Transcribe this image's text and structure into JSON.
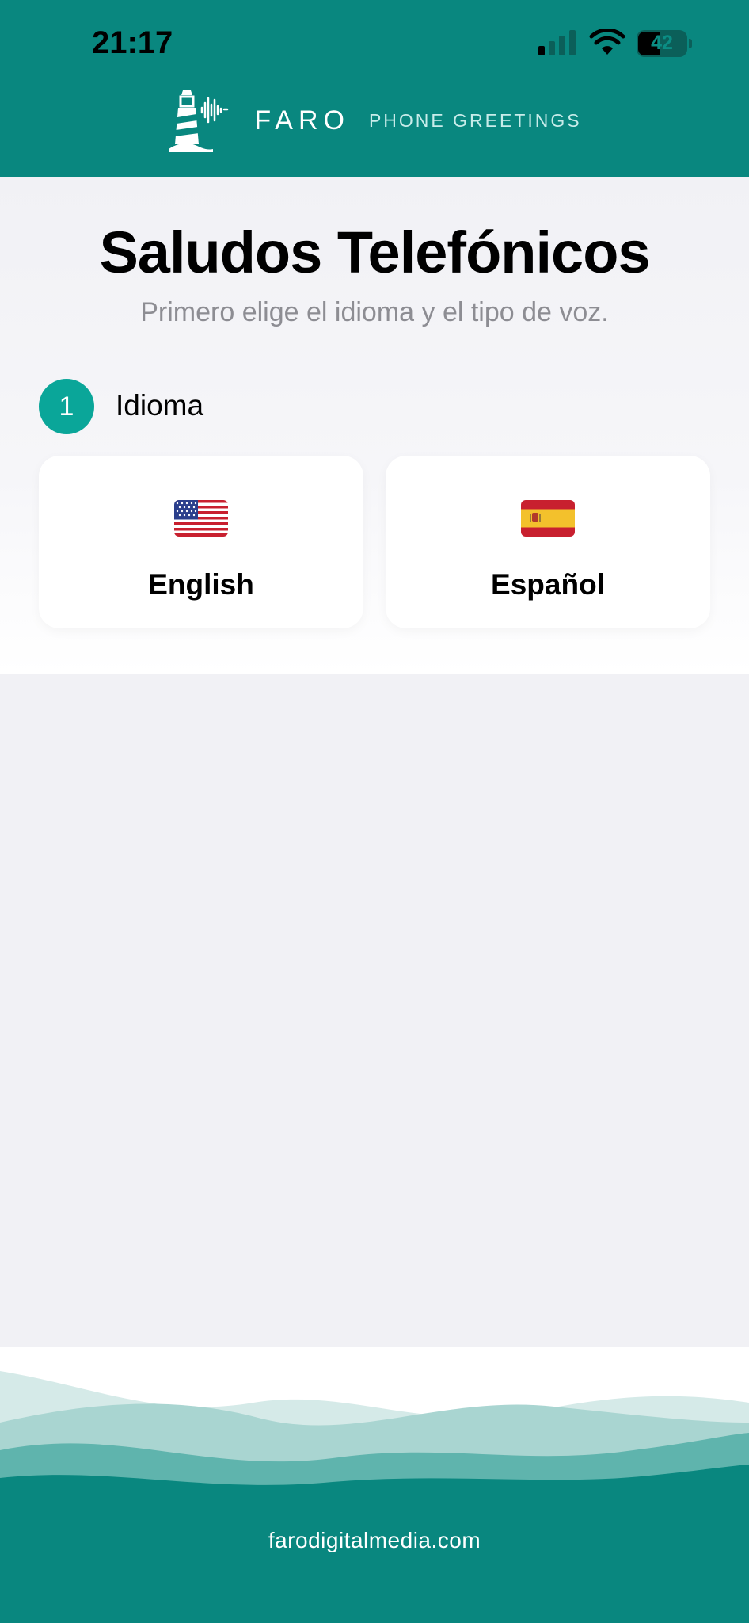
{
  "status_bar": {
    "time": "21:17",
    "battery": "42"
  },
  "brand": {
    "name": "FARO",
    "tagline": "PHONE GREETINGS"
  },
  "page": {
    "title": "Saludos Telefónicos",
    "subtitle": "Primero elige el idioma y el tipo de voz."
  },
  "step": {
    "number": "1",
    "label": "Idioma"
  },
  "languages": [
    {
      "label": "English",
      "flag": "us-flag-icon"
    },
    {
      "label": "Español",
      "flag": "spain-flag-icon"
    }
  ],
  "footer": {
    "url": "farodigitalmedia.com"
  },
  "colors": {
    "header": "#09877f",
    "accent": "#0aa699",
    "background": "#f1f1f5"
  }
}
